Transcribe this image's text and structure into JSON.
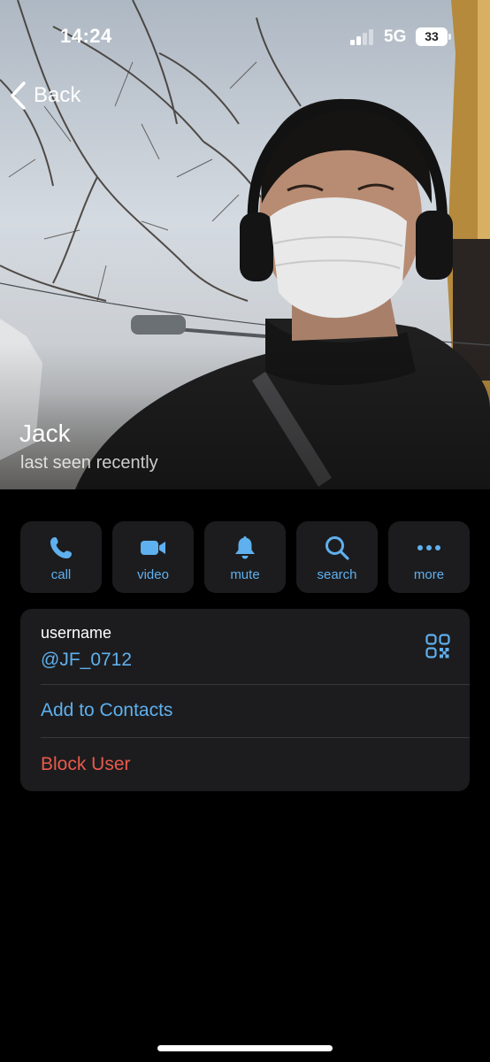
{
  "status_bar": {
    "time": "14:24",
    "network": "5G",
    "battery": "33"
  },
  "nav": {
    "back_label": "Back"
  },
  "profile": {
    "name": "Jack",
    "status": "last seen recently"
  },
  "actions": [
    {
      "label": "call",
      "icon": "phone-icon"
    },
    {
      "label": "video",
      "icon": "video-camera-icon"
    },
    {
      "label": "mute",
      "icon": "bell-icon"
    },
    {
      "label": "search",
      "icon": "search-icon"
    },
    {
      "label": "more",
      "icon": "more-dots-icon"
    }
  ],
  "info": {
    "username_label": "username",
    "username_value": "@JF_0712",
    "add_contact": "Add to Contacts",
    "block_user": "Block User"
  },
  "colors": {
    "accent": "#5fb0ee",
    "danger": "#e9594c",
    "card": "#1c1c1e",
    "background": "#000000"
  }
}
